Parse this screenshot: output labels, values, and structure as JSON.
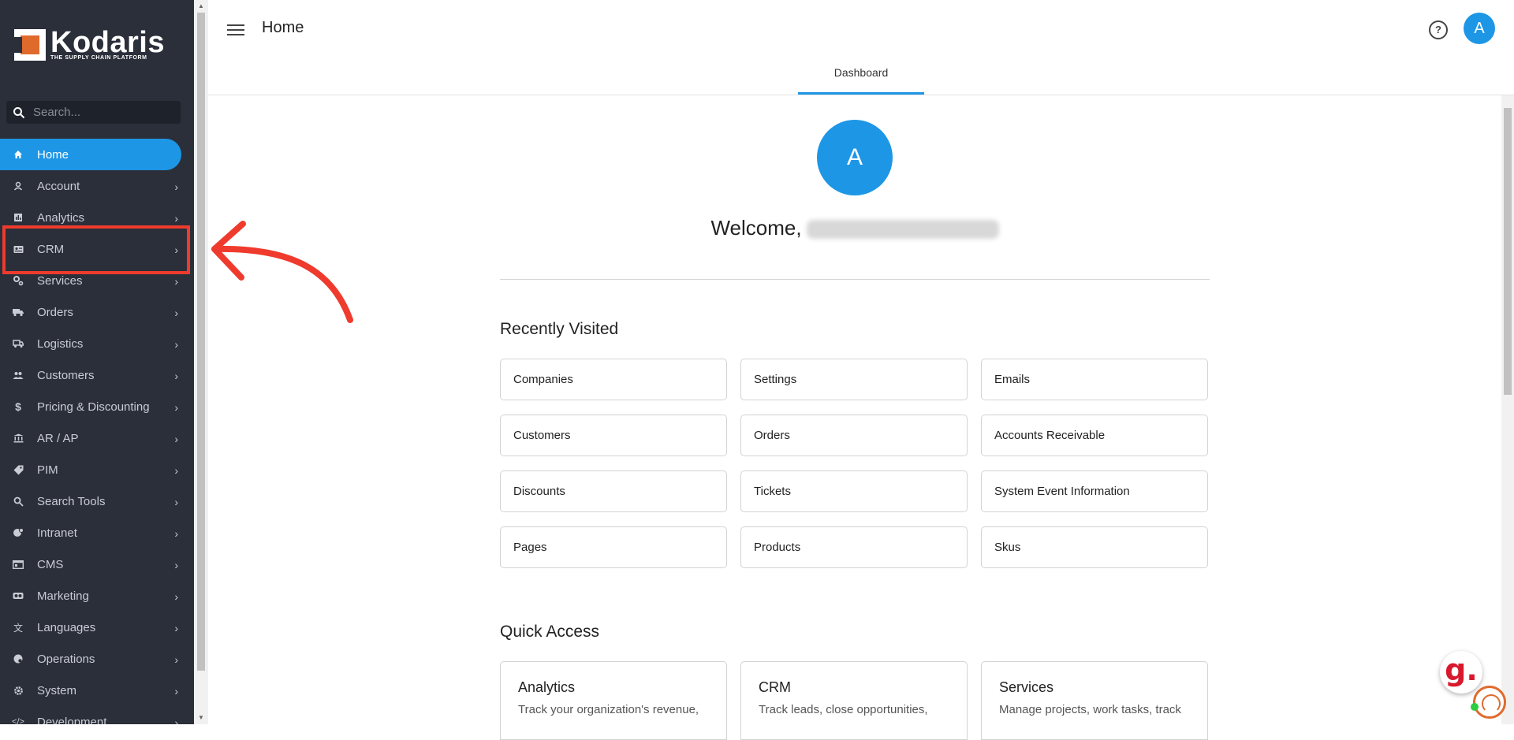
{
  "app": {
    "brand": "Kodaris",
    "brand_tagline": "THE SUPPLY CHAIN PLATFORM"
  },
  "search": {
    "placeholder": "Search..."
  },
  "sidebar": {
    "items": [
      {
        "label": "Home",
        "icon": "home-icon",
        "active": true
      },
      {
        "label": "Account",
        "icon": "person-icon"
      },
      {
        "label": "Analytics",
        "icon": "analytics-icon"
      },
      {
        "label": "CRM",
        "icon": "contact-card-icon",
        "highlighted": true
      },
      {
        "label": "Services",
        "icon": "gears-icon"
      },
      {
        "label": "Orders",
        "icon": "truck-icon"
      },
      {
        "label": "Logistics",
        "icon": "shipping-icon"
      },
      {
        "label": "Customers",
        "icon": "people-icon"
      },
      {
        "label": "Pricing & Discounting",
        "icon": "dollar-icon"
      },
      {
        "label": "AR / AP",
        "icon": "bank-icon"
      },
      {
        "label": "PIM",
        "icon": "tag-icon"
      },
      {
        "label": "Search Tools",
        "icon": "search-icon"
      },
      {
        "label": "Intranet",
        "icon": "intranet-icon"
      },
      {
        "label": "CMS",
        "icon": "cms-icon"
      },
      {
        "label": "Marketing",
        "icon": "marketing-icon"
      },
      {
        "label": "Languages",
        "icon": "translate-icon"
      },
      {
        "label": "Operations",
        "icon": "operations-icon"
      },
      {
        "label": "System",
        "icon": "gear-icon"
      },
      {
        "label": "Development",
        "icon": "code-icon"
      }
    ]
  },
  "header": {
    "title": "Home",
    "avatar_letter": "A",
    "help_glyph": "?",
    "tab": "Dashboard"
  },
  "main": {
    "avatar_letter": "A",
    "welcome": "Welcome,",
    "recently_visited_title": "Recently Visited",
    "recently_visited": [
      "Companies",
      "Settings",
      "Emails",
      "Customers",
      "Orders",
      "Accounts Receivable",
      "Discounts",
      "Tickets",
      "System Event Information",
      "Pages",
      "Products",
      "Skus"
    ],
    "quick_access_title": "Quick Access",
    "quick_access": [
      {
        "title": "Analytics",
        "desc": "Track your organization's revenue,"
      },
      {
        "title": "CRM",
        "desc": "Track leads, close opportunities,"
      },
      {
        "title": "Services",
        "desc": "Manage projects, work tasks, track"
      }
    ]
  },
  "colors": {
    "accent": "#1e96e6",
    "sidebar_bg": "#2b2f3a",
    "highlight": "#ef3b2d",
    "brand_orange": "#e06a2c"
  },
  "widgets": {
    "g_badge": "g."
  }
}
